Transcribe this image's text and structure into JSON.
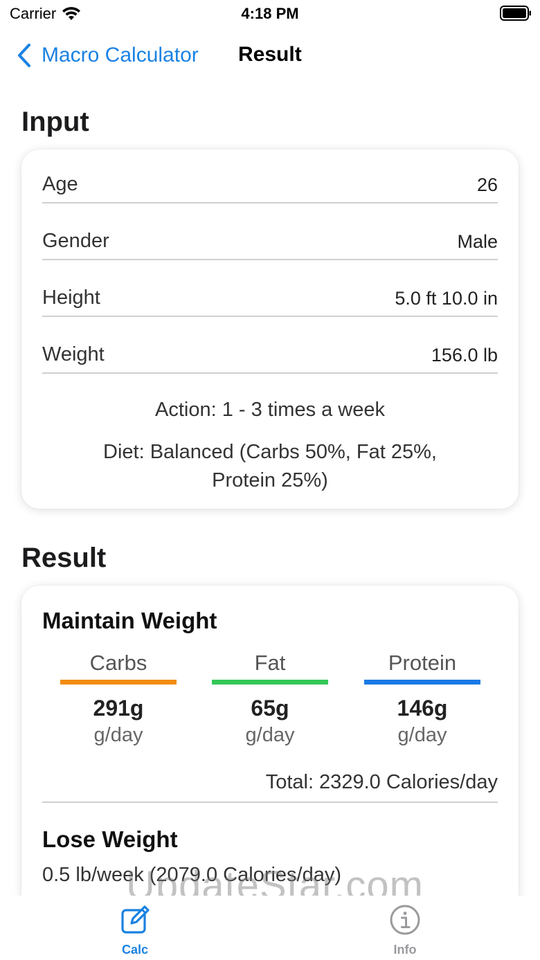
{
  "status_bar": {
    "carrier": "Carrier",
    "time": "4:18 PM"
  },
  "nav": {
    "back_label": "Macro Calculator",
    "title": "Result"
  },
  "input_section": {
    "heading": "Input",
    "rows": [
      {
        "label": "Age",
        "value": "26"
      },
      {
        "label": "Gender",
        "value": "Male"
      },
      {
        "label": "Height",
        "value": "5.0 ft 10.0 in"
      },
      {
        "label": "Weight",
        "value": "156.0 lb"
      }
    ],
    "action": "Action: 1 - 3 times a week",
    "diet_line1": "Diet: Balanced (Carbs 50%, Fat 25%,",
    "diet_line2": "Protein 25%)"
  },
  "result_section": {
    "heading": "Result",
    "maintain_heading": "Maintain Weight",
    "macros": [
      {
        "name": "Carbs",
        "value": "291g",
        "unit": "g/day",
        "color": "#f28c0f"
      },
      {
        "name": "Fat",
        "value": "65g",
        "unit": "g/day",
        "color": "#34c759"
      },
      {
        "name": "Protein",
        "value": "146g",
        "unit": "g/day",
        "color": "#1a7ae6"
      }
    ],
    "total": "Total: 2329.0 Calories/day",
    "lose_heading": "Lose Weight",
    "lose_line": "0.5 lb/week (2079.0 Calories/day)"
  },
  "tab_bar": {
    "tabs": [
      {
        "label": "Calc",
        "icon": "edit-icon",
        "active": true
      },
      {
        "label": "Info",
        "icon": "info-icon",
        "active": false
      }
    ]
  },
  "watermark": "UpdateStar.com",
  "colors": {
    "accent": "#1a82e2",
    "inactive_tab": "#9a9a9e"
  }
}
